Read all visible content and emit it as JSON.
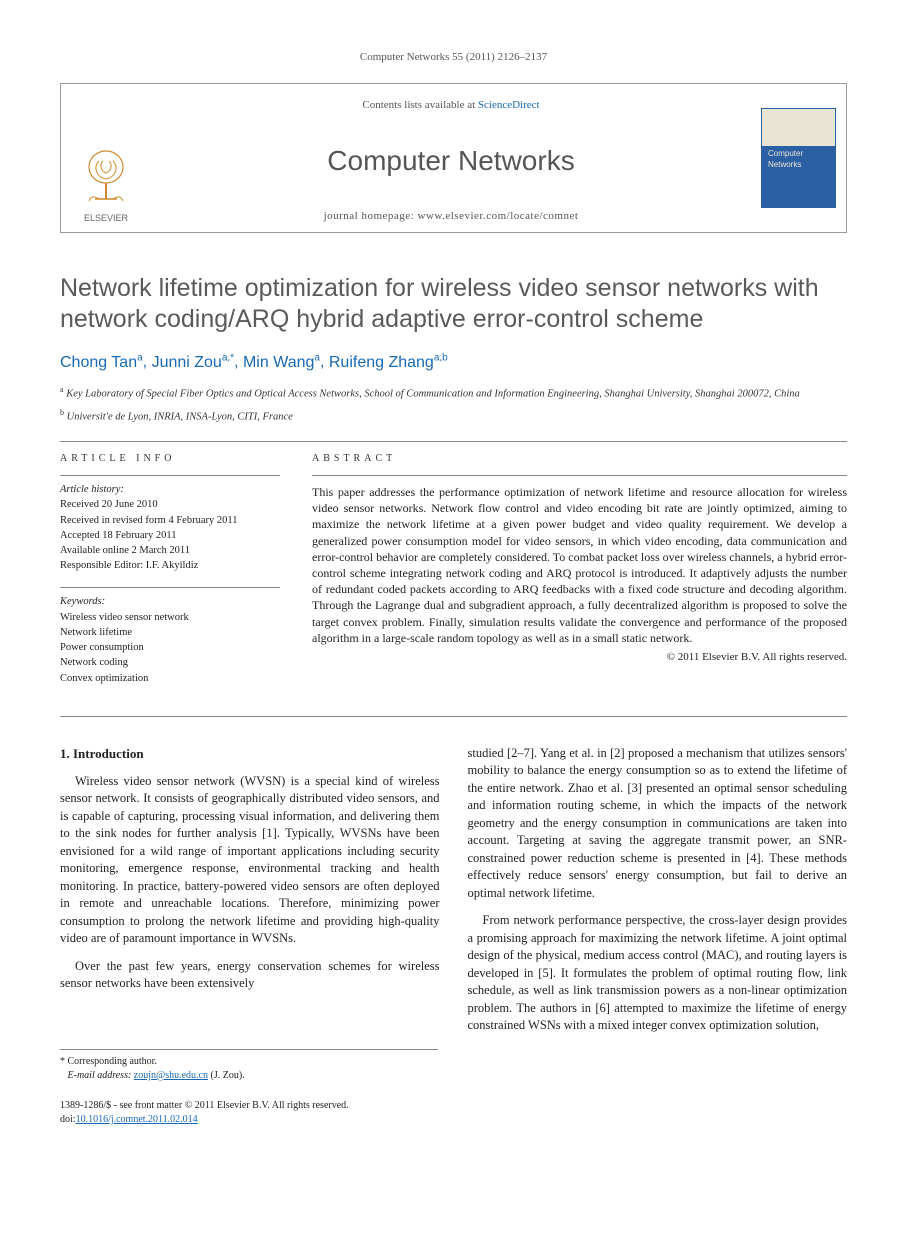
{
  "citation": {
    "journal": "Computer Networks",
    "volume_issue": "55 (2011) 2126–2137"
  },
  "header": {
    "contents_prefix": "Contents lists available at ",
    "contents_link": "ScienceDirect",
    "journal_title": "Computer Networks",
    "homepage_label": "journal homepage: ",
    "homepage_url": "www.elsevier.com/locate/comnet",
    "publisher_logo_label": "ELSEVIER",
    "cover_label": "Computer Networks"
  },
  "article": {
    "title": "Network lifetime optimization for wireless video sensor networks with network coding/ARQ hybrid adaptive error-control scheme",
    "authors_html": "Chong Tan<sup>a</sup>, Junni Zou<sup>a,*</sup>, Min Wang<sup>a</sup>, Ruifeng Zhang<sup>a,b</sup>",
    "authors": [
      {
        "name": "Chong Tan",
        "aff": "a"
      },
      {
        "name": "Junni Zou",
        "aff": "a",
        "corresponding": true
      },
      {
        "name": "Min Wang",
        "aff": "a"
      },
      {
        "name": "Ruifeng Zhang",
        "aff": "a,b"
      }
    ],
    "affiliations": [
      {
        "marker": "a",
        "text": "Key Laboratory of Special Fiber Optics and Optical Access Networks, School of Communication and Information Engineering, Shanghai University, Shanghai 200072, China"
      },
      {
        "marker": "b",
        "text": "Universit'e de Lyon, INRIA, INSA-Lyon, CITI, France"
      }
    ]
  },
  "info": {
    "heading": "article info",
    "history_label": "Article history:",
    "history": [
      "Received 20 June 2010",
      "Received in revised form 4 February 2011",
      "Accepted 18 February 2011",
      "Available online 2 March 2011",
      "Responsible Editor: I.F. Akyildiz"
    ],
    "keywords_label": "Keywords:",
    "keywords": [
      "Wireless video sensor network",
      "Network lifetime",
      "Power consumption",
      "Network coding",
      "Convex optimization"
    ]
  },
  "abstract": {
    "heading": "abstract",
    "text": "This paper addresses the performance optimization of network lifetime and resource allocation for wireless video sensor networks. Network flow control and video encoding bit rate are jointly optimized, aiming to maximize the network lifetime at a given power budget and video quality requirement. We develop a generalized power consumption model for video sensors, in which video encoding, data communication and error-control behavior are completely considered. To combat packet loss over wireless channels, a hybrid error-control scheme integrating network coding and ARQ protocol is introduced. It adaptively adjusts the number of redundant coded packets according to ARQ feedbacks with a fixed code structure and decoding algorithm. Through the Lagrange dual and subgradient approach, a fully decentralized algorithm is proposed to solve the target convex problem. Finally, simulation results validate the convergence and performance of the proposed algorithm in a large-scale random topology as well as in a small static network.",
    "copyright": "© 2011 Elsevier B.V. All rights reserved."
  },
  "body": {
    "section_heading": "1. Introduction",
    "p1": "Wireless video sensor network (WVSN) is a special kind of wireless sensor network. It consists of geographically distributed video sensors, and is capable of capturing, processing visual information, and delivering them to the sink nodes for further analysis [1]. Typically, WVSNs have been envisioned for a wild range of important applications including security monitoring, emergence response, environmental tracking and health monitoring. In practice, battery-powered video sensors are often deployed in remote and unreachable locations. Therefore, minimizing power consumption to prolong the network lifetime and providing high-quality video are of paramount importance in WVSNs.",
    "p2": "Over the past few years, energy conservation schemes for wireless sensor networks have been extensively",
    "p3": "studied [2–7]. Yang et al. in [2] proposed a mechanism that utilizes sensors' mobility to balance the energy consumption so as to extend the lifetime of the entire network. Zhao et al. [3] presented an optimal sensor scheduling and information routing scheme, in which the impacts of the network geometry and the energy consumption in communications are taken into account. Targeting at saving the aggregate transmit power, an SNR-constrained power reduction scheme is presented in [4]. These methods effectively reduce sensors' energy consumption, but fail to derive an optimal network lifetime.",
    "p4": "From network performance perspective, the cross-layer design provides a promising approach for maximizing the network lifetime. A joint optimal design of the physical, medium access control (MAC), and routing layers is developed in [5]. It formulates the problem of optimal routing flow, link schedule, as well as link transmission powers as a non-linear optimization problem. The authors in [6] attempted to maximize the lifetime of energy constrained WSNs with a mixed integer convex optimization solution,"
  },
  "footnotes": {
    "corresponding": "* Corresponding author.",
    "email_label": "E-mail address: ",
    "email": "zoujn@shu.edu.cn",
    "email_attribution": " (J. Zou)."
  },
  "bottom": {
    "issn_line": "1389-1286/$ - see front matter © 2011 Elsevier B.V. All rights reserved.",
    "doi_label": "doi:",
    "doi": "10.1016/j.comnet.2011.02.014"
  }
}
